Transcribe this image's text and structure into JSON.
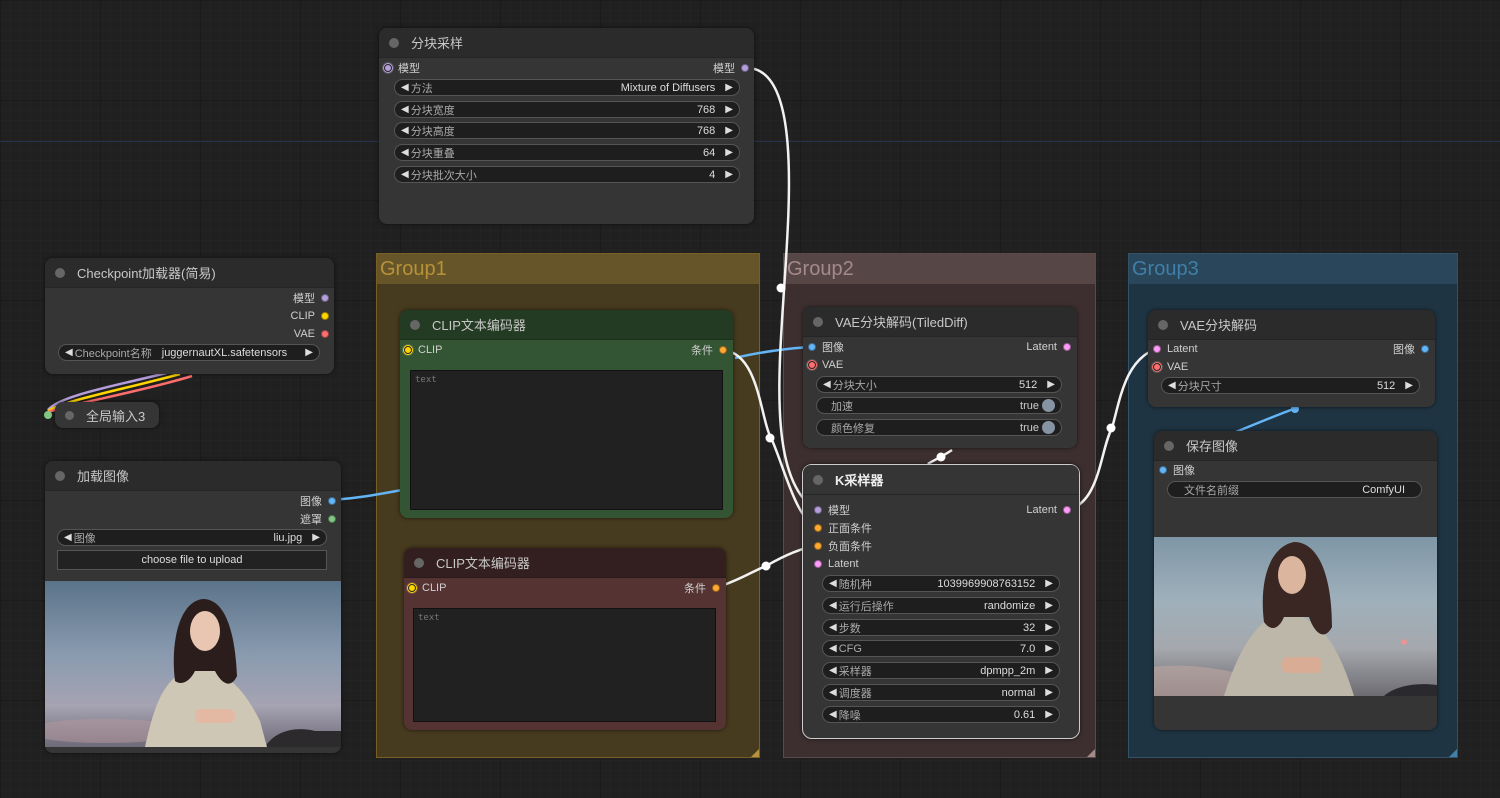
{
  "canvas": {
    "background": "#202020"
  },
  "groups": [
    {
      "id": "group1",
      "title": "Group1",
      "color": "#b8923a"
    },
    {
      "id": "group2",
      "title": "Group2",
      "color": "#a58a8a"
    },
    {
      "id": "group3",
      "title": "Group3",
      "color": "#3f7fa8"
    }
  ],
  "slot_colors": {
    "model": "#b39ddb",
    "clip": "#ffd500",
    "vae": "#ff6e6e",
    "image": "#64b5f6",
    "mask": "#81c784",
    "conditioning": "#ffa931",
    "latent": "#ff9cf9"
  },
  "nodes": {
    "tiled_sampler": {
      "title": "分块采样",
      "input_model": "模型",
      "output_model": "模型",
      "widgets": [
        {
          "label": "方法",
          "value": "Mixture of Diffusers"
        },
        {
          "label": "分块宽度",
          "value": "768"
        },
        {
          "label": "分块高度",
          "value": "768"
        },
        {
          "label": "分块重叠",
          "value": "64"
        },
        {
          "label": "分块批次大小",
          "value": "4"
        }
      ]
    },
    "checkpoint_loader": {
      "title": "Checkpoint加载器(简易)",
      "outputs": [
        "模型",
        "CLIP",
        "VAE"
      ],
      "widget": {
        "label": "Checkpoint名称",
        "value": "juggernautXL.safetensors"
      }
    },
    "global_input": {
      "title": "全局输入3"
    },
    "load_image": {
      "title": "加载图像",
      "outputs": [
        "图像",
        "遮罩"
      ],
      "widget": {
        "label": "图像",
        "value": "liu.jpg"
      },
      "upload_button": "choose file to upload"
    },
    "clip_pos": {
      "title": "CLIP文本编码器",
      "input": "CLIP",
      "output": "条件",
      "placeholder": "text",
      "color": "#335533"
    },
    "clip_neg": {
      "title": "CLIP文本编码器",
      "input": "CLIP",
      "output": "条件",
      "placeholder": "text",
      "color": "#553333"
    },
    "vae_encode_tiled": {
      "title": "VAE分块解码(TiledDiff)",
      "inputs": [
        "图像",
        "VAE"
      ],
      "output": "Latent",
      "widgets": [
        {
          "label": "分块大小",
          "value": "512",
          "type": "number"
        },
        {
          "label": "加速",
          "value": "true",
          "type": "toggle"
        },
        {
          "label": "颜色修复",
          "value": "true",
          "type": "toggle"
        }
      ]
    },
    "ksampler": {
      "title": "K采样器",
      "inputs": [
        "模型",
        "正面条件",
        "负面条件",
        "Latent"
      ],
      "output": "Latent",
      "widgets": [
        {
          "label": "随机种",
          "value": "1039969908763152"
        },
        {
          "label": "运行后操作",
          "value": "randomize"
        },
        {
          "label": "步数",
          "value": "32"
        },
        {
          "label": "CFG",
          "value": "7.0"
        },
        {
          "label": "采样器",
          "value": "dpmpp_2m"
        },
        {
          "label": "调度器",
          "value": "normal"
        },
        {
          "label": "降噪",
          "value": "0.61"
        }
      ]
    },
    "vae_decode_tiled": {
      "title": "VAE分块解码",
      "inputs": [
        "Latent",
        "VAE"
      ],
      "output": "图像",
      "widget": {
        "label": "分块尺寸",
        "value": "512"
      }
    },
    "save_image": {
      "title": "保存图像",
      "input": "图像",
      "widget": {
        "label": "文件名前缀",
        "value": "ComfyUI"
      }
    }
  },
  "icons": {
    "arrow_left": "◀",
    "arrow_right": "▶"
  }
}
